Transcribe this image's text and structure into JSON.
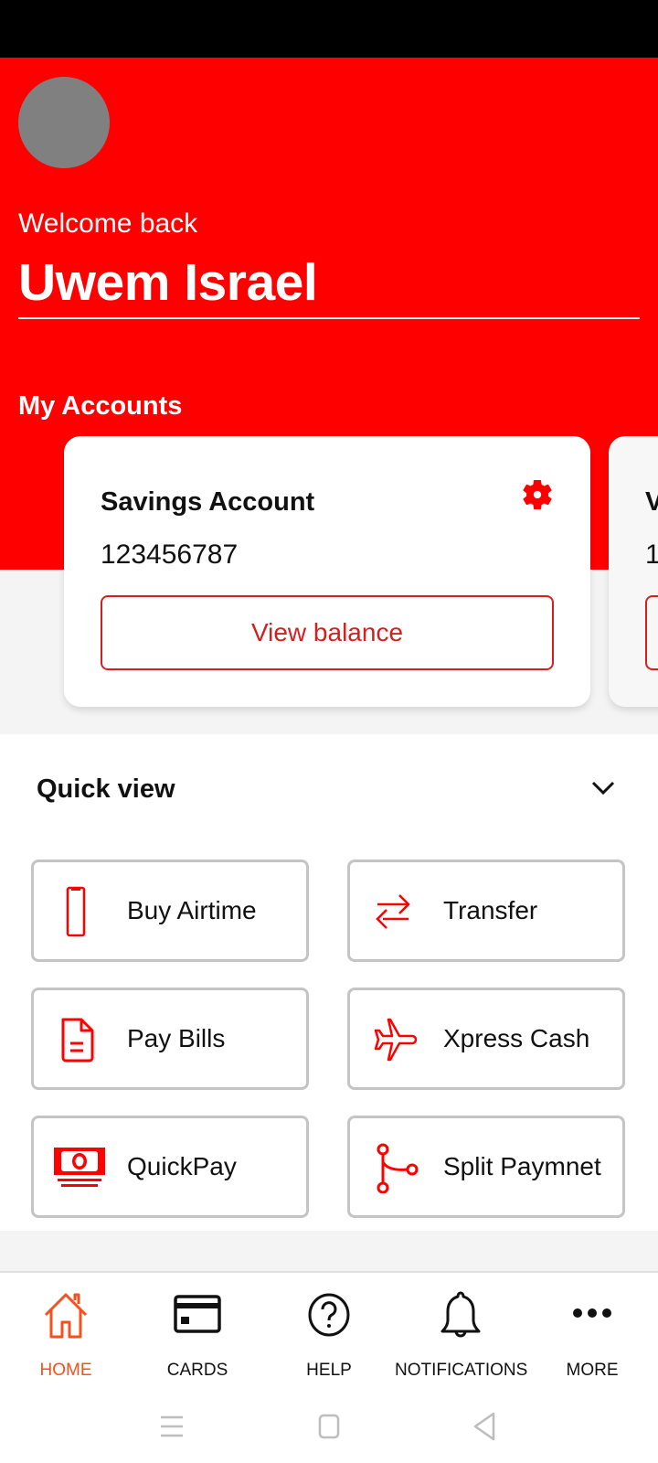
{
  "header": {
    "greeting": "Welcome back",
    "user_name": "Uwem Israel",
    "accounts_title": "My Accounts"
  },
  "accounts": [
    {
      "title": "Savings Account",
      "number": "123456787",
      "view_balance_label": "View balance",
      "settings_icon": "gear-icon"
    },
    {
      "title": "V",
      "number": "1"
    }
  ],
  "quick_view": {
    "title": "Quick view",
    "toggle_icon": "chevron-down-icon",
    "items": [
      {
        "label": "Buy Airtime",
        "icon": "phone-icon"
      },
      {
        "label": "Transfer",
        "icon": "transfer-arrows-icon"
      },
      {
        "label": "Pay Bills",
        "icon": "document-icon"
      },
      {
        "label": "Xpress Cash",
        "icon": "airplane-icon"
      },
      {
        "label": "QuickPay",
        "icon": "cash-icon"
      },
      {
        "label": "Split Paymnet",
        "icon": "split-icon"
      }
    ]
  },
  "bottom_nav": {
    "items": [
      {
        "label": "HOME",
        "icon": "home-icon",
        "active": true
      },
      {
        "label": "CARDS",
        "icon": "card-icon",
        "active": false
      },
      {
        "label": "HELP",
        "icon": "help-icon",
        "active": false
      },
      {
        "label": "NOTIFICATIONS",
        "icon": "bell-icon",
        "active": false
      },
      {
        "label": "MORE",
        "icon": "more-icon",
        "active": false
      }
    ]
  },
  "colors": {
    "brand_red": "#ff0000",
    "accent_red": "#d51f1f",
    "active_nav": "#f4511e",
    "avatar_gray": "#808080"
  }
}
